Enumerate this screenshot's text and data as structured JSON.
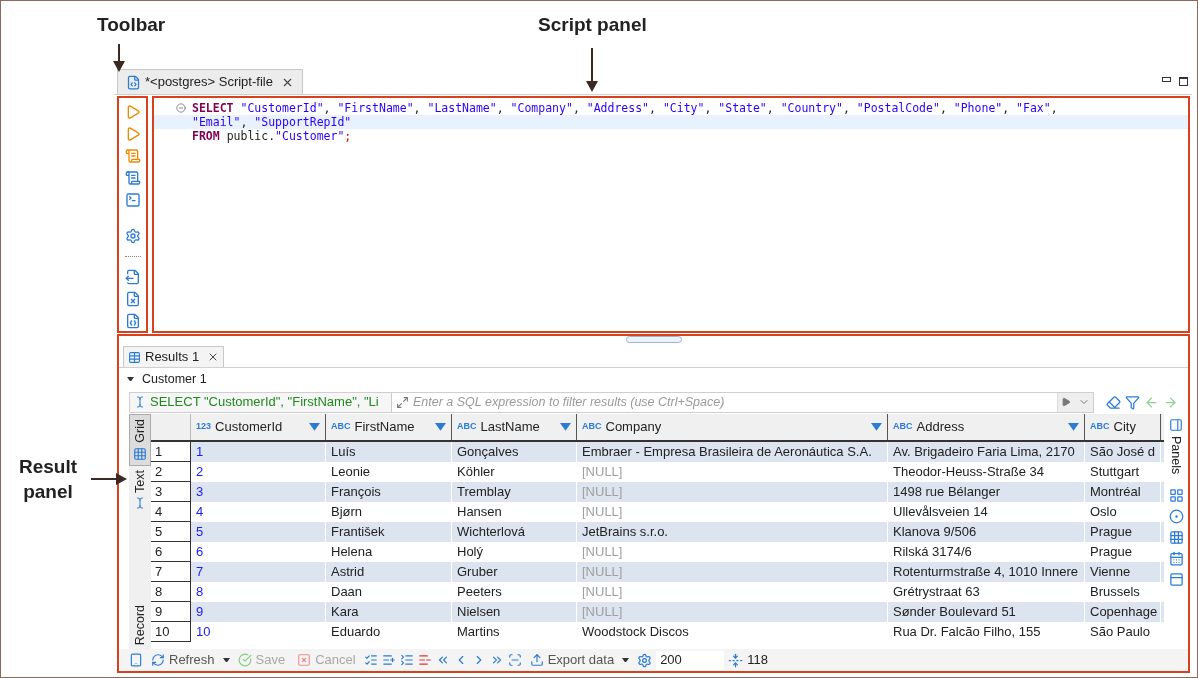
{
  "annotations": [
    {
      "label": "Toolbar"
    },
    {
      "label": "Script panel"
    },
    {
      "label": "Result panel"
    }
  ],
  "editor_tab": {
    "title": "*<postgres> Script-file"
  },
  "script": {
    "lines": [
      {
        "current": false,
        "folded": false,
        "tokens": [
          {
            "kind": "keyword",
            "text": "SELECT"
          },
          {
            "kind": "string",
            "text": "\"CustomerId\""
          },
          {
            "kind": "plain",
            "text": ", "
          },
          {
            "kind": "string",
            "text": "\"FirstName\""
          },
          {
            "kind": "plain",
            "text": ", "
          },
          {
            "kind": "string",
            "text": "\"LastName\""
          },
          {
            "kind": "plain",
            "text": ", "
          },
          {
            "kind": "string",
            "text": "\"Company\""
          },
          {
            "kind": "plain",
            "text": ", "
          },
          {
            "kind": "string",
            "text": "\"Address\""
          },
          {
            "kind": "plain",
            "text": ", "
          },
          {
            "kind": "string",
            "text": "\"City\""
          },
          {
            "kind": "plain",
            "text": ", "
          },
          {
            "kind": "string",
            "text": "\"State\""
          },
          {
            "kind": "plain",
            "text": ", "
          },
          {
            "kind": "string",
            "text": "\"Country\""
          },
          {
            "kind": "plain",
            "text": ", "
          },
          {
            "kind": "string",
            "text": "\"PostalCode\""
          },
          {
            "kind": "plain",
            "text": ", "
          },
          {
            "kind": "string",
            "text": "\"Phone\""
          },
          {
            "kind": "plain",
            "text": ", "
          },
          {
            "kind": "string",
            "text": "\"Fax\""
          },
          {
            "kind": "plain",
            "text": ","
          }
        ]
      },
      {
        "current": true,
        "tokens": [
          {
            "kind": "string",
            "text": "\"Email\""
          },
          {
            "kind": "plain",
            "text": ", "
          },
          {
            "kind": "string",
            "text": "\"SupportRepId\""
          }
        ]
      },
      {
        "current": false,
        "tokens": [
          {
            "kind": "keyword",
            "text": "FROM"
          },
          {
            "kind": "plain",
            "text": "public."
          },
          {
            "kind": "string",
            "text": "\"Customer\""
          },
          {
            "kind": "error",
            "text": ";"
          }
        ]
      }
    ]
  },
  "results_tab": {
    "title": "Results 1"
  },
  "query_node": {
    "label": "Customer 1",
    "expanded": true
  },
  "filter": {
    "query": "SELECT \"CustomerId\", \"FirstName\", \"Li",
    "placeholder": "Enter a SQL expression to filter results (use Ctrl+Space)"
  },
  "view_tabs": [
    {
      "label": "Grid",
      "selected": true
    },
    {
      "label": "Text",
      "selected": false
    },
    {
      "label": "Record",
      "selected": false
    }
  ],
  "panels_label": "Panels",
  "columns": [
    {
      "type": "123",
      "name": "CustomerId"
    },
    {
      "type": "ABC",
      "name": "FirstName"
    },
    {
      "type": "ABC",
      "name": "LastName"
    },
    {
      "type": "ABC",
      "name": "Company"
    },
    {
      "type": "ABC",
      "name": "Address"
    },
    {
      "type": "ABC",
      "name": "City"
    }
  ],
  "rows": [
    {
      "number": "1",
      "cells": [
        {
          "text": "1",
          "null": false
        },
        {
          "text": "Luís",
          "null": false
        },
        {
          "text": "Gonçalves",
          "null": false
        },
        {
          "text": "Embraer - Empresa Brasileira de Aeronáutica S.A.",
          "null": false
        },
        {
          "text": "Av. Brigadeiro Faria Lima, 2170",
          "null": false
        },
        {
          "text": "São José d",
          "null": false
        }
      ]
    },
    {
      "number": "2",
      "cells": [
        {
          "text": "2",
          "null": false
        },
        {
          "text": "Leonie",
          "null": false
        },
        {
          "text": "Köhler",
          "null": false
        },
        {
          "text": "[NULL]",
          "null": true
        },
        {
          "text": "Theodor-Heuss-Straße 34",
          "null": false
        },
        {
          "text": "Stuttgart",
          "null": false
        }
      ]
    },
    {
      "number": "3",
      "cells": [
        {
          "text": "3",
          "null": false
        },
        {
          "text": "François",
          "null": false
        },
        {
          "text": "Tremblay",
          "null": false
        },
        {
          "text": "[NULL]",
          "null": true
        },
        {
          "text": "1498 rue Bélanger",
          "null": false
        },
        {
          "text": "Montréal",
          "null": false
        }
      ]
    },
    {
      "number": "4",
      "cells": [
        {
          "text": "4",
          "null": false
        },
        {
          "text": "Bjørn",
          "null": false
        },
        {
          "text": "Hansen",
          "null": false
        },
        {
          "text": "[NULL]",
          "null": true
        },
        {
          "text": "Ullevålsveien 14",
          "null": false
        },
        {
          "text": "Oslo",
          "null": false
        }
      ]
    },
    {
      "number": "5",
      "cells": [
        {
          "text": "5",
          "null": false
        },
        {
          "text": "František",
          "null": false
        },
        {
          "text": "Wichterlová",
          "null": false
        },
        {
          "text": "JetBrains s.r.o.",
          "null": false
        },
        {
          "text": "Klanova 9/506",
          "null": false
        },
        {
          "text": "Prague",
          "null": false
        }
      ]
    },
    {
      "number": "6",
      "cells": [
        {
          "text": "6",
          "null": false
        },
        {
          "text": "Helena",
          "null": false
        },
        {
          "text": "Holý",
          "null": false
        },
        {
          "text": "[NULL]",
          "null": true
        },
        {
          "text": "Rilská 3174/6",
          "null": false
        },
        {
          "text": "Prague",
          "null": false
        }
      ]
    },
    {
      "number": "7",
      "cells": [
        {
          "text": "7",
          "null": false
        },
        {
          "text": "Astrid",
          "null": false
        },
        {
          "text": "Gruber",
          "null": false
        },
        {
          "text": "[NULL]",
          "null": true
        },
        {
          "text": "Rotenturmstraße 4, 1010 Innere",
          "null": false
        },
        {
          "text": "Vienne",
          "null": false
        }
      ]
    },
    {
      "number": "8",
      "cells": [
        {
          "text": "8",
          "null": false
        },
        {
          "text": "Daan",
          "null": false
        },
        {
          "text": "Peeters",
          "null": false
        },
        {
          "text": "[NULL]",
          "null": true
        },
        {
          "text": "Grétrystraat 63",
          "null": false
        },
        {
          "text": "Brussels",
          "null": false
        }
      ]
    },
    {
      "number": "9",
      "cells": [
        {
          "text": "9",
          "null": false
        },
        {
          "text": "Kara",
          "null": false
        },
        {
          "text": "Nielsen",
          "null": false
        },
        {
          "text": "[NULL]",
          "null": true
        },
        {
          "text": "Sønder Boulevard 51",
          "null": false
        },
        {
          "text": "Copenhage",
          "null": false
        }
      ]
    },
    {
      "number": "10",
      "cells": [
        {
          "text": "10",
          "null": false
        },
        {
          "text": "Eduardo",
          "null": false
        },
        {
          "text": "Martins",
          "null": false
        },
        {
          "text": "Woodstock Discos",
          "null": false
        },
        {
          "text": "Rua Dr. Falcão Filho, 155",
          "null": false
        },
        {
          "text": "São Paulo",
          "null": false
        }
      ]
    }
  ],
  "bottom_toolbar": {
    "refresh": {
      "label": "Refresh",
      "disabled": false
    },
    "save": {
      "label": "Save",
      "disabled": true
    },
    "cancel": {
      "label": "Cancel",
      "disabled": true
    },
    "export": {
      "label": "Export data",
      "disabled": false
    },
    "fetch_size": "200",
    "row_count": "118"
  }
}
